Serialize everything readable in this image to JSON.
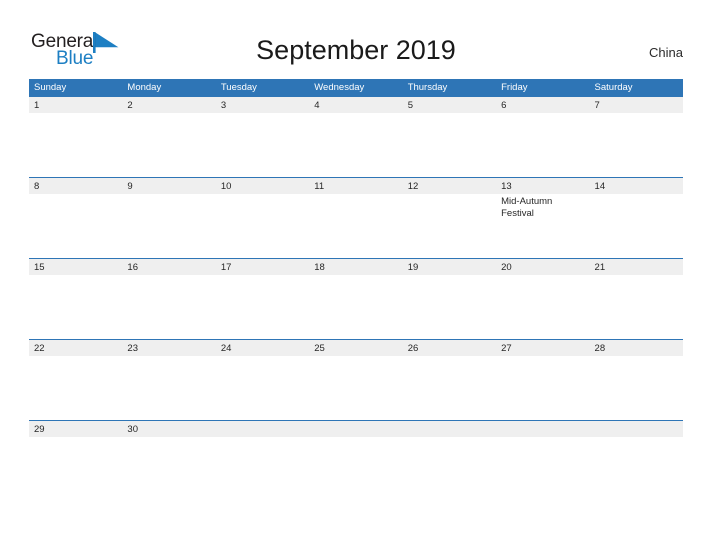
{
  "brand": {
    "name_line1": "General",
    "name_line2": "Blue",
    "flag_icon": "blue-triangle-flag-icon",
    "accent_color": "#1d7fc3"
  },
  "header": {
    "title": "September 2019",
    "country": "China"
  },
  "calendar": {
    "month": "September",
    "year": "2019",
    "header_color": "#2e75b6",
    "date_band_color": "#efefef",
    "weekdays": [
      "Sunday",
      "Monday",
      "Tuesday",
      "Wednesday",
      "Thursday",
      "Friday",
      "Saturday"
    ],
    "weeks": [
      {
        "days": [
          {
            "number": "1",
            "event": ""
          },
          {
            "number": "2",
            "event": ""
          },
          {
            "number": "3",
            "event": ""
          },
          {
            "number": "4",
            "event": ""
          },
          {
            "number": "5",
            "event": ""
          },
          {
            "number": "6",
            "event": ""
          },
          {
            "number": "7",
            "event": ""
          }
        ]
      },
      {
        "days": [
          {
            "number": "8",
            "event": ""
          },
          {
            "number": "9",
            "event": ""
          },
          {
            "number": "10",
            "event": ""
          },
          {
            "number": "11",
            "event": ""
          },
          {
            "number": "12",
            "event": ""
          },
          {
            "number": "13",
            "event": "Mid-Autumn Festival"
          },
          {
            "number": "14",
            "event": ""
          }
        ]
      },
      {
        "days": [
          {
            "number": "15",
            "event": ""
          },
          {
            "number": "16",
            "event": ""
          },
          {
            "number": "17",
            "event": ""
          },
          {
            "number": "18",
            "event": ""
          },
          {
            "number": "19",
            "event": ""
          },
          {
            "number": "20",
            "event": ""
          },
          {
            "number": "21",
            "event": ""
          }
        ]
      },
      {
        "days": [
          {
            "number": "22",
            "event": ""
          },
          {
            "number": "23",
            "event": ""
          },
          {
            "number": "24",
            "event": ""
          },
          {
            "number": "25",
            "event": ""
          },
          {
            "number": "26",
            "event": ""
          },
          {
            "number": "27",
            "event": ""
          },
          {
            "number": "28",
            "event": ""
          }
        ]
      },
      {
        "days": [
          {
            "number": "29",
            "event": ""
          },
          {
            "number": "30",
            "event": ""
          },
          {
            "number": "",
            "event": ""
          },
          {
            "number": "",
            "event": ""
          },
          {
            "number": "",
            "event": ""
          },
          {
            "number": "",
            "event": ""
          },
          {
            "number": "",
            "event": ""
          }
        ]
      }
    ]
  }
}
